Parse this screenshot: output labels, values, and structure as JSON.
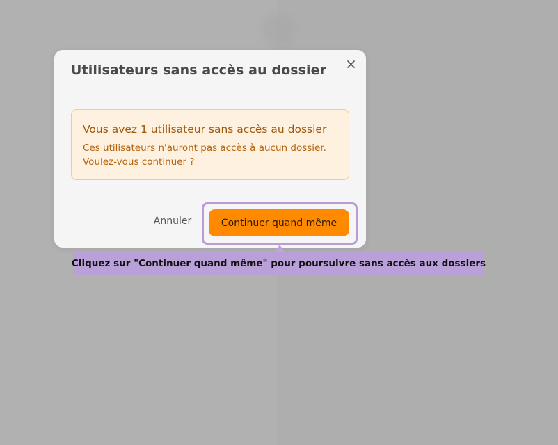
{
  "modal": {
    "title": "Utilisateurs sans accès au dossier",
    "close_icon": "close-icon"
  },
  "warning": {
    "title": "Vous avez 1 utilisateur sans accès au dossier",
    "message": "Ces utilisateurs n'auront pas accès à aucun dossier. Voulez-vous continuer ?"
  },
  "footer": {
    "cancel_label": "Annuler",
    "confirm_label": "Continuer quand même"
  },
  "tooltip": {
    "text": "Cliquez sur \"Continuer quand même\" pour poursuivre sans accès aux dossiers"
  },
  "colors": {
    "backdrop": "#b1b1b1",
    "modal_bg": "#f5f5f5",
    "warning_bg": "#fff1e0",
    "warning_border": "#f7c98a",
    "warning_text": "#a0580b",
    "primary": "#ff8a00",
    "highlight": "#b79cd6",
    "tooltip_bg": "#b9a0d9"
  }
}
